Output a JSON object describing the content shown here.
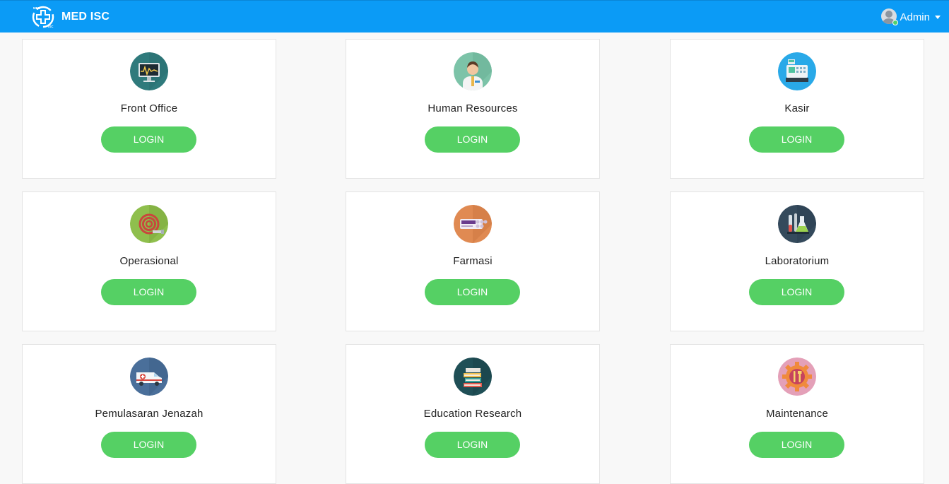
{
  "header": {
    "brand_name": "MED ISC",
    "logo_text_top": "MED",
    "logo_text_bottom": "ISC",
    "user_name": "Admin",
    "bar_color": "#0b9bf6"
  },
  "modules": [
    {
      "title": "Front Office",
      "button_label": "LOGIN",
      "icon": "monitor-icon",
      "icon_color": "#2f7a7c"
    },
    {
      "title": "Human Resources",
      "button_label": "LOGIN",
      "icon": "doctor-icon",
      "icon_color": "#7cc3a8"
    },
    {
      "title": "Kasir",
      "button_label": "LOGIN",
      "icon": "cash-register-icon",
      "icon_color": "#29a9e8"
    },
    {
      "title": "Operasional",
      "button_label": "LOGIN",
      "icon": "hose-icon",
      "icon_color": "#8fbf4d"
    },
    {
      "title": "Farmasi",
      "button_label": "LOGIN",
      "icon": "pill-strip-icon",
      "icon_color": "#e08a52"
    },
    {
      "title": "Laboratorium",
      "button_label": "LOGIN",
      "icon": "lab-flask-icon",
      "icon_color": "#344a5c"
    },
    {
      "title": "Pemulasaran Jenazah",
      "button_label": "LOGIN",
      "icon": "ambulance-icon",
      "icon_color": "#4a6f9a"
    },
    {
      "title": "Education Research",
      "button_label": "LOGIN",
      "icon": "books-icon",
      "icon_color": "#1f4f56"
    },
    {
      "title": "Maintenance",
      "button_label": "LOGIN",
      "icon": "gear-tools-icon",
      "icon_color": "#e4a0b8"
    }
  ],
  "colors": {
    "login_button": "#55d064"
  }
}
